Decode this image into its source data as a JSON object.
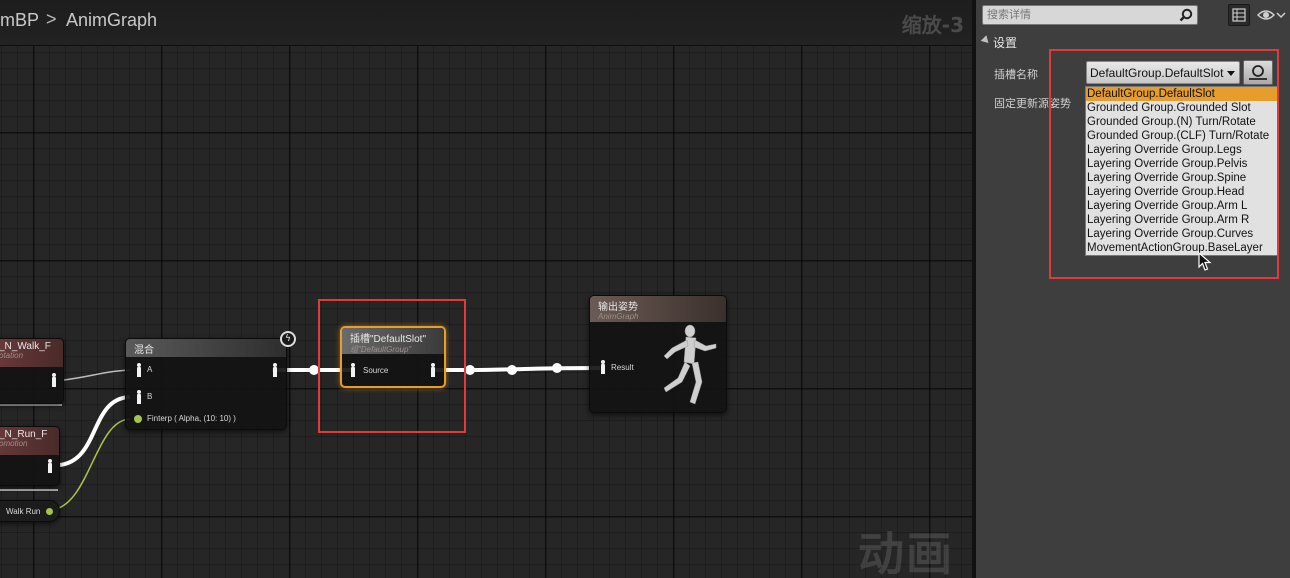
{
  "graph": {
    "breadcrumb": {
      "blueprint": "mBP",
      "separator": ">",
      "graph": "AnimGraph"
    },
    "zoom_label": "缩放-3",
    "watermark": "动画",
    "nodes": {
      "walk": {
        "title": "_N_Walk_F",
        "subtitle": "otation"
      },
      "run": {
        "title": "_N_Run_F",
        "subtitle": "omotion"
      },
      "walkrun": {
        "label": "Walk Run"
      },
      "blend": {
        "title": "混合",
        "pin_a": "A",
        "pin_b": "B",
        "alpha": "Finterp ( Alpha,  (10: 10) )"
      },
      "slot": {
        "title": "插槽\"DefaultSlot\"",
        "subtitle": "组\"DefaultGroup\"",
        "pin_source": "Source"
      },
      "output": {
        "title": "输出姿势",
        "subtitle": "AnimGraph",
        "pin_result": "Result"
      }
    }
  },
  "details": {
    "search_placeholder": "搜索详情",
    "section_title": "设置",
    "slot_name_label": "插槽名称",
    "fixed_update_label": "固定更新源姿势",
    "slot_value": "DefaultGroup.DefaultSlot",
    "slot_options": [
      "DefaultGroup.DefaultSlot",
      "Grounded Group.Grounded Slot",
      "Grounded Group.(N) Turn/Rotate",
      "Grounded Group.(CLF) Turn/Rotate",
      "Layering Override Group.Legs",
      "Layering Override Group.Pelvis",
      "Layering Override Group.Spine",
      "Layering Override Group.Head",
      "Layering Override Group.Arm L",
      "Layering Override Group.Arm R",
      "Layering Override Group.Curves",
      "MovementActionGroup.BaseLayer"
    ],
    "selected_index": 0
  },
  "colors": {
    "selection": "#e79d2b",
    "highlight_box": "#e03a3a",
    "exec_wire": "#ffffff",
    "float_wire": "#a6c34a"
  },
  "icons": [
    "search-icon",
    "grid-view-icon",
    "eye-icon",
    "browse-icon",
    "pose-pin-icon",
    "mannequin-icon",
    "cursor-icon",
    "lightning-icon"
  ]
}
